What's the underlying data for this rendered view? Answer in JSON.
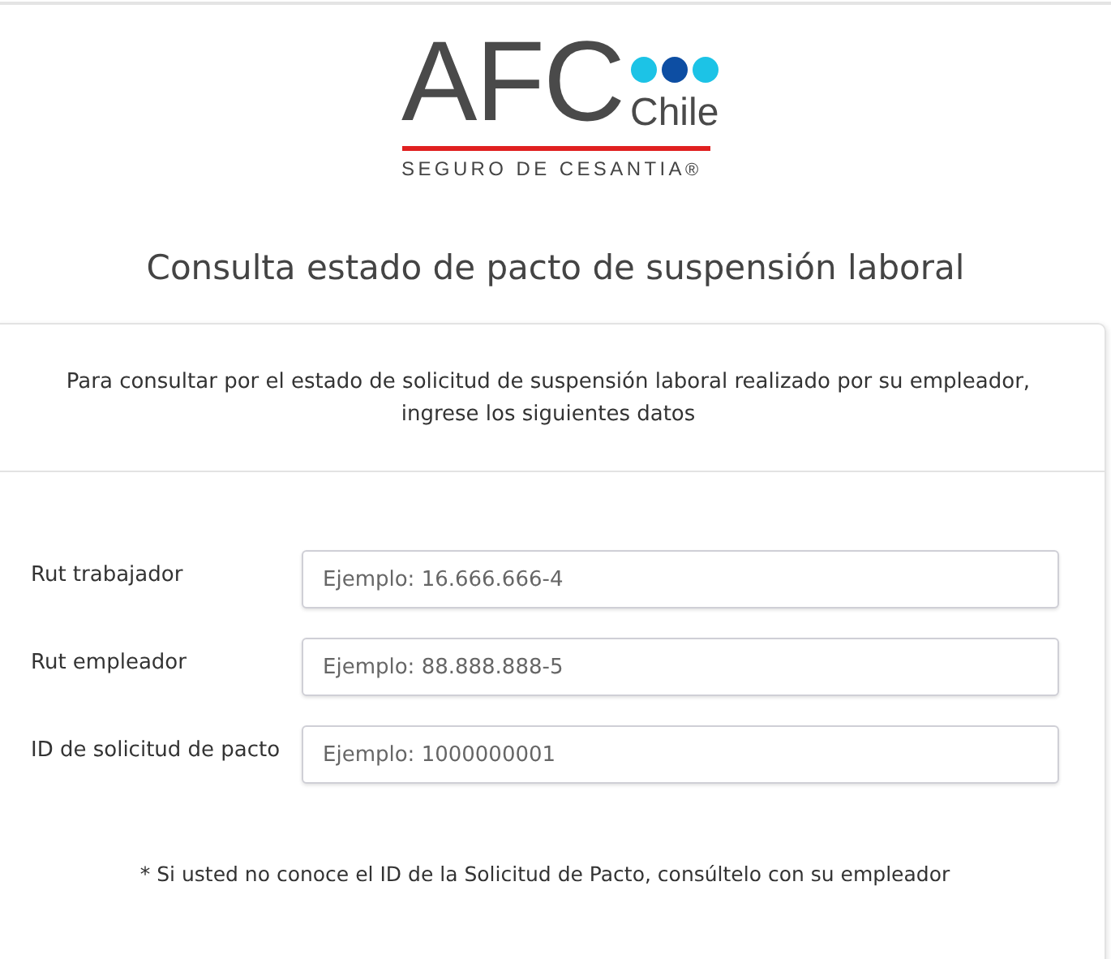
{
  "logo": {
    "brand": "AFC",
    "country": "Chile",
    "tagline": "SEGURO DE CESANTIA",
    "mark": "®"
  },
  "title": "Consulta estado de pacto de suspensión laboral",
  "intro": "Para consultar por el estado de solicitud de suspensión laboral realizado por su empleador, ingrese los siguientes datos",
  "fields": [
    {
      "label": "Rut trabajador",
      "placeholder": "Ejemplo: 16.666.666-4"
    },
    {
      "label": "Rut empleador",
      "placeholder": "Ejemplo: 88.888.888-5"
    },
    {
      "label": "ID de solicitud de pacto",
      "placeholder": "Ejemplo: 1000000001"
    }
  ],
  "note": "* Si usted no conoce el ID de la Solicitud de Pacto, consúltelo con su empleador"
}
